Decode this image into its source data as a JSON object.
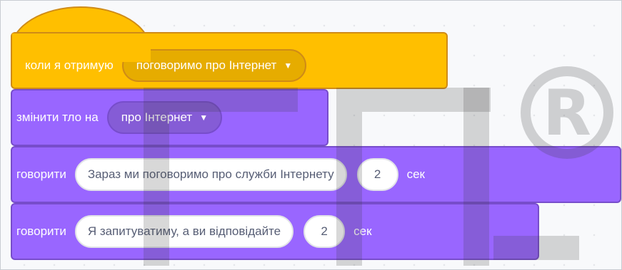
{
  "script": {
    "hat": {
      "label": "коли я отримую",
      "message": "поговоримо про Інтернет"
    },
    "backdrop": {
      "label": "змінити тло на",
      "value": "про Інтернет"
    },
    "say1": {
      "label": "говорити",
      "text": "Зараз ми поговоримо про служби Інтернету",
      "secs": "2",
      "unit": "сек"
    },
    "say2": {
      "label": "говорити",
      "text": "Я запитуватиму, а ви відповідайте",
      "secs": "2",
      "unit": "сек"
    }
  },
  "icons": {
    "dropdown": "▼"
  },
  "colors": {
    "event": "#ffbf00",
    "looks": "#9966ff",
    "workspace": "#f8f9fb"
  },
  "watermark": {
    "symbol": "R"
  }
}
